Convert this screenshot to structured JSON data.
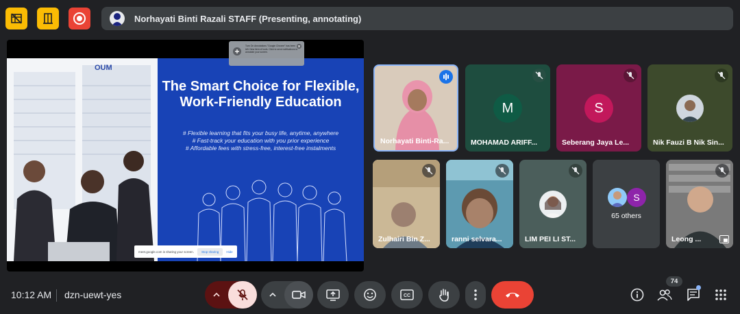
{
  "colors": {
    "background": "#202124",
    "accent_yellow": "#fbbc04",
    "record_red": "#ea4335",
    "slide_blue": "#1843b6",
    "end_call_red": "#ea4335",
    "mic_off_bg": "#f9dedc"
  },
  "top_bar": {
    "icons": [
      "no-video-grid-icon",
      "door-icon",
      "record-icon"
    ],
    "presenter_label": "Norhayati Binti Razali STAFF (Presenting, annotating)"
  },
  "slide": {
    "title": "The Smart Choice for Flexible, Work-Friendly Education",
    "bullets": [
      "# Flexible learning that fits your busy life, anytime, anywhere",
      "# Fast-track your education with you prior experience",
      "# Affordable fees with stress-free, interest-free instalments"
    ],
    "logo_text": "OUM",
    "tooltip_text": "Turn On Annotations \"Google Chrome\" has been left. New item of tools. Click to send notifications to annotate your screen.",
    "share_bar_text": "meet.google.com is sharing your screen.",
    "share_bar_stop": "Stop sharing",
    "share_bar_hide": "Hide"
  },
  "participants": [
    {
      "name": "Norhayati Binti-Ra...",
      "speaking": true,
      "avatar": "video"
    },
    {
      "name": "MOHAMAD ARIFF...",
      "initial": "M",
      "muted": true
    },
    {
      "name": "Seberang Jaya Le...",
      "initial": "S",
      "muted": true
    },
    {
      "name": "Nik Fauzi B Nik Sin...",
      "muted": true,
      "avatar": "photo"
    },
    {
      "name": "Zulhairi Bin Z...",
      "muted": true,
      "avatar": "video"
    },
    {
      "name": "ranni selvara...",
      "muted": true,
      "avatar": "video"
    },
    {
      "name": "LIM PEI LI ST...",
      "muted": true,
      "avatar": "photo"
    },
    {
      "name": "65 others",
      "initial": "S"
    },
    {
      "name": "Leong ...",
      "muted": true,
      "avatar": "video"
    }
  ],
  "bottom_bar": {
    "time": "10:12 AM",
    "meeting_code": "dzn-uewt-yes",
    "people_count": "74"
  }
}
